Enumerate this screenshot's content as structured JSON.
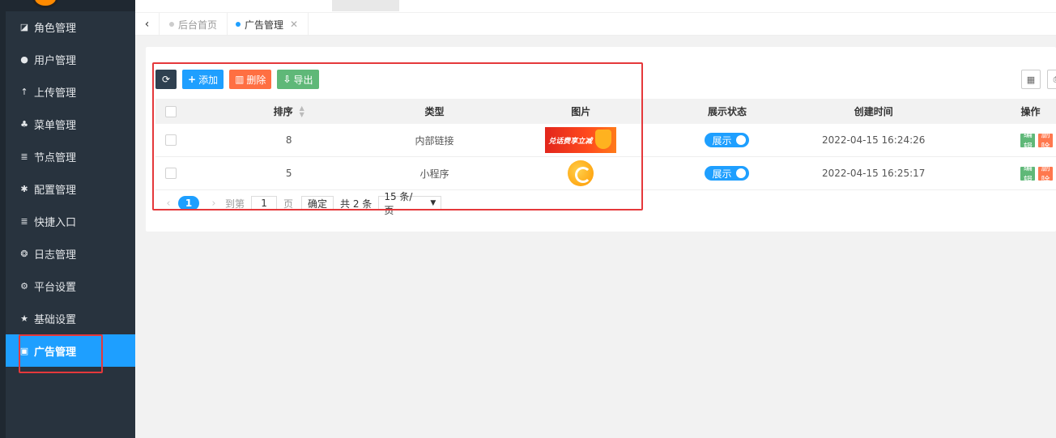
{
  "sidebar": {
    "items": [
      {
        "icon": "role-icon",
        "glyph": "◪",
        "label": "角色管理"
      },
      {
        "icon": "user-icon",
        "glyph": "●",
        "label": "用户管理"
      },
      {
        "icon": "upload-icon",
        "glyph": "↑",
        "label": "上传管理"
      },
      {
        "icon": "tree-icon",
        "glyph": "♣",
        "label": "菜单管理"
      },
      {
        "icon": "list-icon",
        "glyph": "≣",
        "label": "节点管理"
      },
      {
        "icon": "asterisk-icon",
        "glyph": "✱",
        "label": "配置管理"
      },
      {
        "icon": "list-icon",
        "glyph": "≣",
        "label": "快捷入口"
      },
      {
        "icon": "log-icon",
        "glyph": "❂",
        "label": "日志管理"
      },
      {
        "icon": "cogs-icon",
        "glyph": "⚙",
        "label": "平台设置"
      },
      {
        "icon": "star-icon",
        "glyph": "★",
        "label": "基础设置"
      },
      {
        "icon": "image-icon",
        "glyph": "▣",
        "label": "广告管理"
      }
    ]
  },
  "tabs": {
    "back_glyph": "‹",
    "items": [
      {
        "label": "后台首页"
      },
      {
        "label": "广告管理",
        "close": "✕"
      }
    ]
  },
  "toolbar": {
    "refresh_glyph": "⟳",
    "add_label": "添加",
    "delete_label": "删除",
    "export_label": "导出"
  },
  "table": {
    "columns": [
      "排序",
      "类型",
      "图片",
      "展示状态",
      "创建时间",
      "操作"
    ],
    "rows": [
      {
        "sort": "8",
        "type": "内部链接",
        "image_text": "兑话费享立减",
        "status": "展示",
        "created": "2022-04-15 16:24:26",
        "edit": "编辑",
        "delete": "删除"
      },
      {
        "sort": "5",
        "type": "小程序",
        "image_text": "",
        "status": "展示",
        "created": "2022-04-15 16:25:17",
        "edit": "编辑",
        "delete": "删除"
      }
    ]
  },
  "pager": {
    "prev": "‹",
    "current": "1",
    "next": "›",
    "goto_prefix": "到第",
    "goto_value": "1",
    "goto_suffix": "页",
    "confirm": "确定",
    "total": "共 2 条",
    "page_size": "15 条/页",
    "caret": "▼"
  },
  "colors": {
    "accent": "#1e9fff",
    "sidebar": "#28333e",
    "highlight": "#e5383b"
  }
}
